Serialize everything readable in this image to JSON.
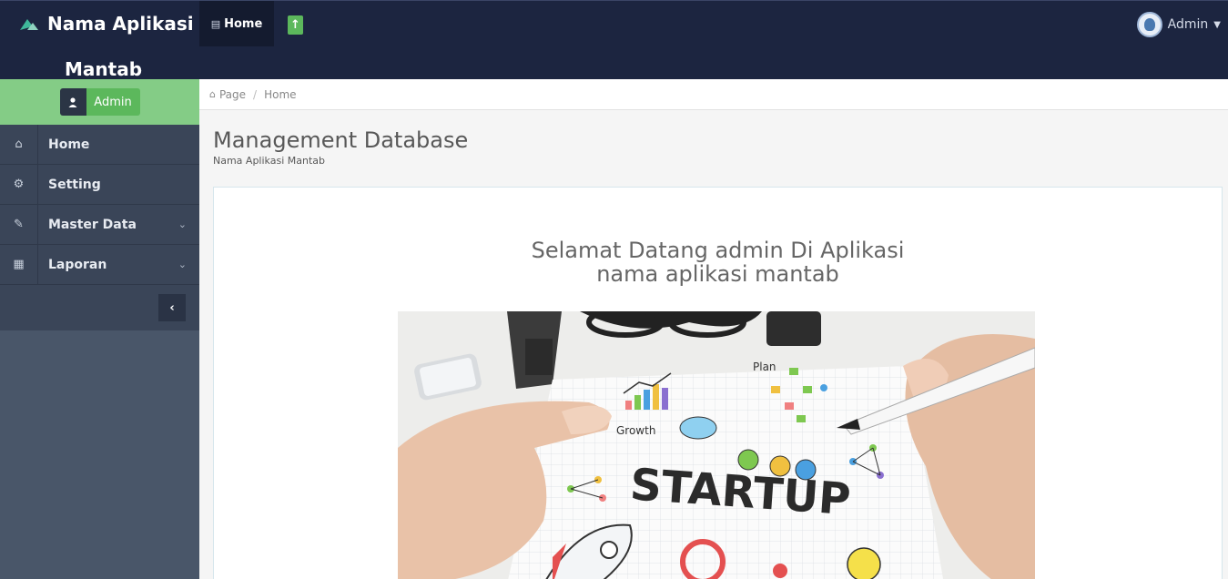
{
  "header": {
    "brand_line1": "Nama Aplikasi",
    "brand_line2": "Mantab",
    "nav_home": "Home",
    "user_name": "Admin"
  },
  "sidebar": {
    "user_label": "Admin",
    "items": [
      {
        "label": "Home",
        "icon": "home-icon",
        "has_submenu": false
      },
      {
        "label": "Setting",
        "icon": "cogs-icon",
        "has_submenu": false
      },
      {
        "label": "Master Data",
        "icon": "edit-icon",
        "has_submenu": true
      },
      {
        "label": "Laporan",
        "icon": "calendar-icon",
        "has_submenu": true
      }
    ]
  },
  "breadcrumb": {
    "items": [
      "Page",
      "Home"
    ]
  },
  "main": {
    "title": "Management Database",
    "subtitle": "Nama Aplikasi Mantab",
    "welcome_line1": "Selamat Datang admin Di Aplikasi",
    "welcome_line2": "nama aplikasi mantab",
    "hero_text": "STARTUP",
    "hero_label_growth": "Growth",
    "hero_label_plan": "Plan"
  },
  "colors": {
    "topbar": "#1c2540",
    "sidebar": "#495669",
    "sidebar_menu": "#3a4558",
    "accent_green": "#5cb85c",
    "user_strip": "#84cc86"
  }
}
